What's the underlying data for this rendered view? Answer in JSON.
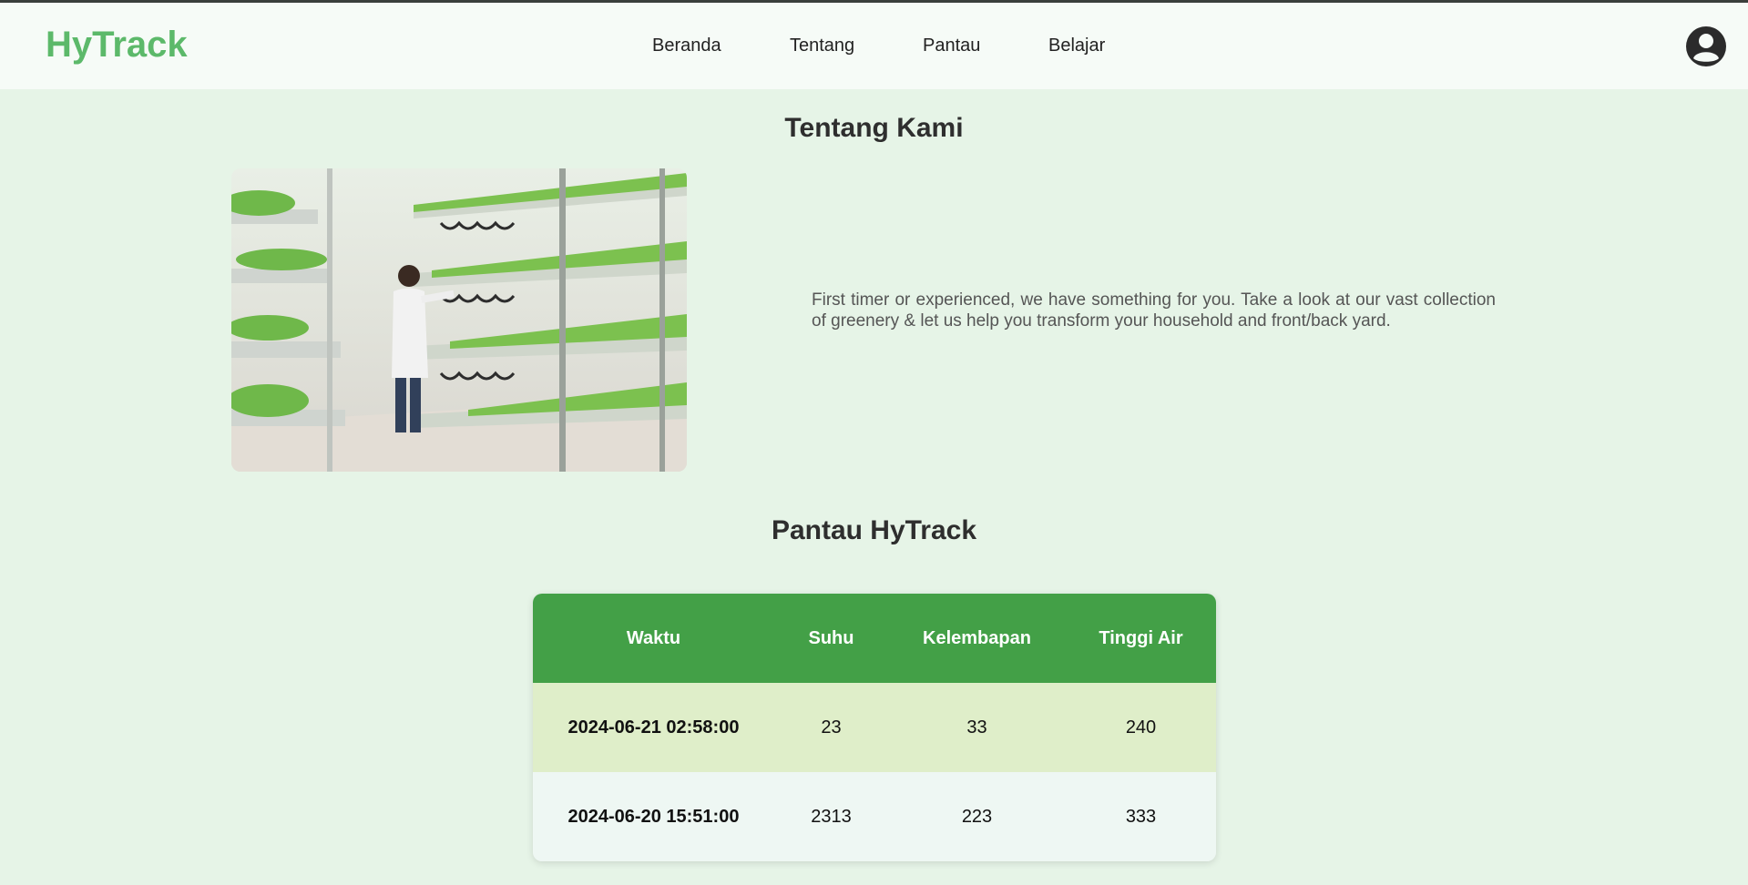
{
  "brand": {
    "logo": "HyTrack"
  },
  "nav": {
    "items": [
      {
        "label": "Beranda"
      },
      {
        "label": "Tentang"
      },
      {
        "label": "Pantau"
      },
      {
        "label": "Belajar"
      }
    ]
  },
  "about": {
    "title": "Tentang Kami",
    "text": "First timer or experienced, we have something for you. Take a look at our vast collection of greenery & let us help you transform your household and front/back yard."
  },
  "monitor": {
    "title": "Pantau HyTrack",
    "columns": [
      "Waktu",
      "Suhu",
      "Kelembapan",
      "Tinggi Air"
    ],
    "rows": [
      [
        "2024-06-21 02:58:00",
        "23",
        "33",
        "240"
      ],
      [
        "2024-06-20 15:51:00",
        "2313",
        "223",
        "333"
      ]
    ]
  },
  "colors": {
    "brand": "#5cb96a",
    "table_header": "#43a047",
    "row_odd": "#dfeec9",
    "row_even": "#eef7f3",
    "page_bg": "#e6f4e7"
  },
  "icons": {
    "account": "user-circle-icon"
  }
}
